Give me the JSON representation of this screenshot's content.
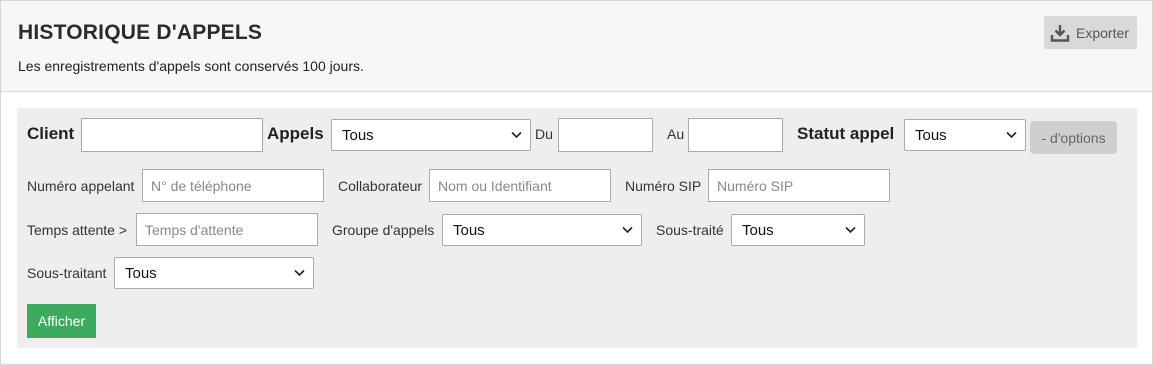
{
  "header": {
    "title": "HISTORIQUE D'APPELS",
    "subtitle": "Les enregistrements d'appels sont conservés 100 jours.",
    "export_label": "Exporter",
    "export_icon": "download-icon"
  },
  "filters": {
    "client_label": "Client",
    "client_value": "",
    "appels_label": "Appels",
    "appels_value": "Tous",
    "du_label": "Du",
    "du_value": "",
    "au_label": "Au",
    "au_value": "",
    "statut_label": "Statut appel",
    "statut_value": "Tous",
    "less_options_label": "- d'options",
    "numero_appelant_label": "Numéro appelant",
    "numero_appelant_placeholder": "N° de téléphone",
    "collaborateur_label": "Collaborateur",
    "collaborateur_placeholder": "Nom ou Identifiant",
    "numero_sip_label": "Numéro SIP",
    "numero_sip_placeholder": "Numéro SIP",
    "temps_attente_label": "Temps attente >",
    "temps_attente_placeholder": "Temps d'attente",
    "groupe_label": "Groupe d'appels",
    "groupe_value": "Tous",
    "sous_traite_label": "Sous-traité",
    "sous_traite_value": "Tous",
    "sous_traitant_label": "Sous-traitant",
    "sous_traitant_value": "Tous",
    "submit_label": "Afficher"
  },
  "colors": {
    "submit": "#3cab5f",
    "panel": "#eeeeee"
  }
}
